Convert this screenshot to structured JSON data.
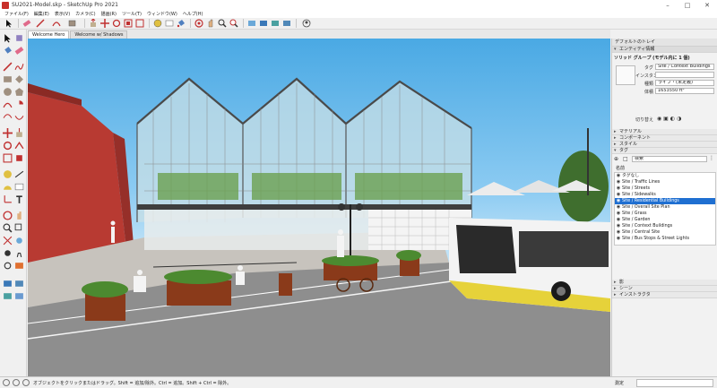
{
  "window": {
    "title": "SU2021-Model.skp - SketchUp Pro 2021"
  },
  "menu": [
    "ファイル(F)",
    "編集(E)",
    "表示(V)",
    "カメラ(C)",
    "描画(R)",
    "ツール(T)",
    "ウィンドウ(W)",
    "ヘルプ(H)"
  ],
  "tabs": [
    {
      "label": "Welcome Hero",
      "active": true
    },
    {
      "label": "Welcome w/ Shadows",
      "active": false
    }
  ],
  "tray": {
    "title": "デフォルトのトレイ",
    "entity_info": {
      "header": "エンティティ情報",
      "object": "ソリッド グループ (モデル内に 1 個)",
      "tag_label": "タグ",
      "tag_value": "Site / Context Buildings",
      "instance_label": "インスタンス",
      "instance_value": "",
      "type_label": "種類",
      "type_value": "ライブ・(未定義)",
      "volume_label": "体積",
      "volume_value": "1653550 ft³",
      "toggle_label": "切り替え"
    },
    "sections": [
      "マテリアル",
      "コンポーネント",
      "スタイル",
      "タグ"
    ],
    "tags": {
      "search_placeholder": "検索",
      "column_header": "名前",
      "items": [
        "タグなし",
        "Site / Traffic Lines",
        "Site / Streets",
        "Site / Sidewalks",
        "Site / Residential Buildings",
        "Site / Overall Site Plan",
        "Site / Grass",
        "Site / Garden",
        "Site / Context Buildings",
        "Site / Central Site",
        "Site / Bus Stops & Street Lights"
      ],
      "selected_index": 4
    },
    "bottom_sections": [
      "影",
      "シーン",
      "インストラクタ"
    ]
  },
  "status": {
    "text": "オブジェクトをクリックまたはドラッグ。Shift = 追加/除外。Ctrl = 追加。Shift + Ctrl = 除外。",
    "measure_label": "測定"
  },
  "colors": {
    "sky": "#4aa9e4",
    "selection": "#1f6fd1",
    "accent_red": "#c8302a"
  }
}
